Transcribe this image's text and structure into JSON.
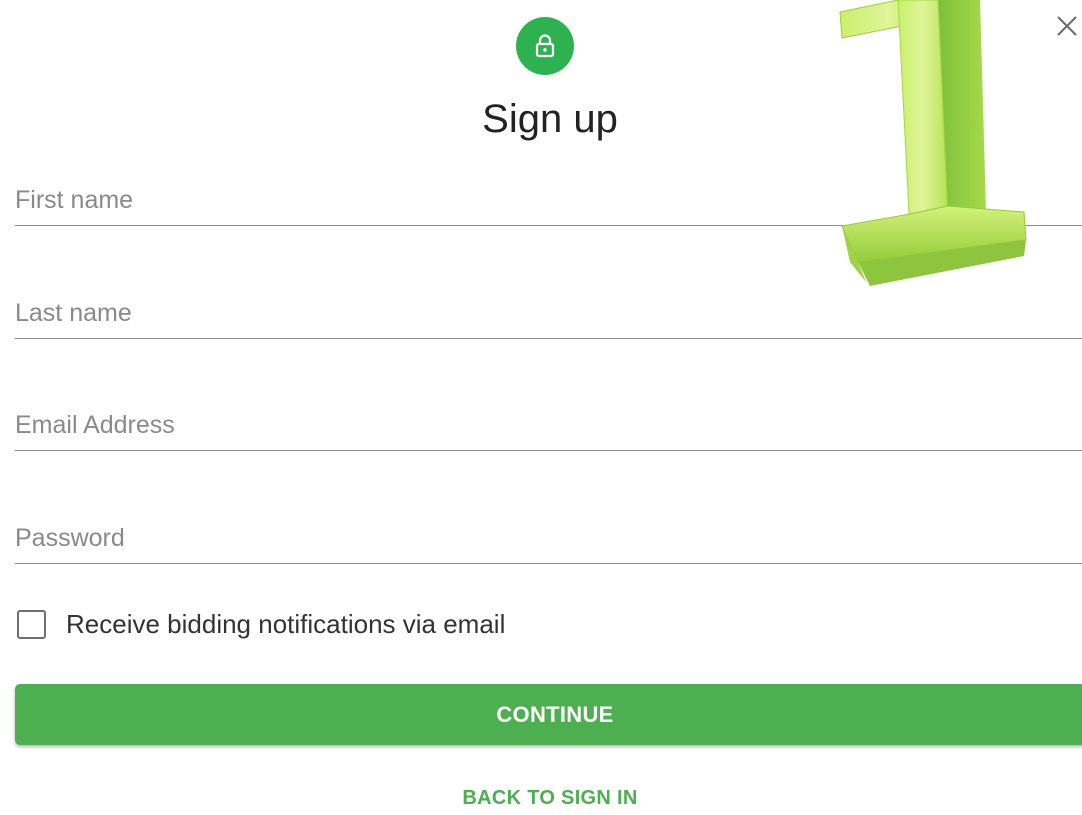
{
  "dialog": {
    "title": "Sign up",
    "close_icon": "close-icon",
    "avatar_icon": "lock-icon",
    "accent_color": "#4caf50"
  },
  "form": {
    "first_name": {
      "placeholder": "First name",
      "value": ""
    },
    "last_name": {
      "placeholder": "Last name",
      "value": ""
    },
    "email": {
      "placeholder": "Email Address",
      "value": ""
    },
    "password": {
      "placeholder": "Password",
      "value": ""
    },
    "notifications_checkbox": {
      "label": "Receive bidding notifications via email",
      "checked": false
    }
  },
  "actions": {
    "continue_label": "CONTINUE",
    "back_label": "BACK TO SIGN IN"
  },
  "overlay": {
    "step_number_graphic": "number-one-icon"
  }
}
